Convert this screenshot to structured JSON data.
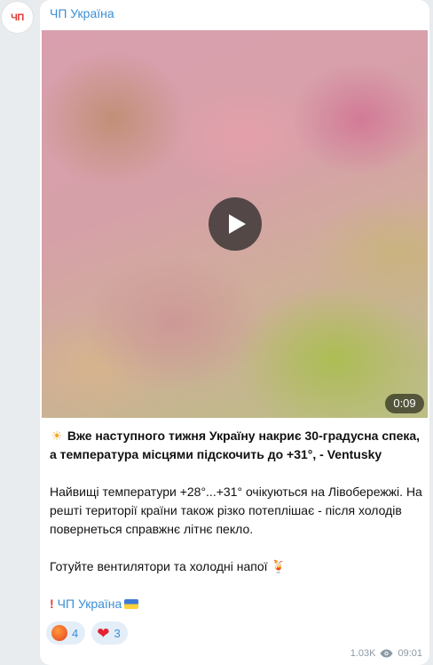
{
  "channel": {
    "avatar_text": "ЧП",
    "name": "ЧП Україна"
  },
  "video": {
    "duration": "0:09",
    "play_icon": "play-icon"
  },
  "post": {
    "headline": "Вже наступного тижня Україну накриє 30-градусна спека, а температура місцями підскочить до +31°, - Ventusky",
    "paragraph1": "Найвищі температури +28°...+31° очікуються на Лівобережжі. На решті території країни також різко потеплішає - після холодів повернеться справжнє літнє пекло.",
    "paragraph2": "Готуйте вентилятори та холодні напої",
    "signature": "ЧП Україна"
  },
  "reactions": [
    {
      "icon": "angry-face-icon",
      "count": "4"
    },
    {
      "icon": "heart-icon",
      "count": "3"
    }
  ],
  "meta": {
    "views": "1.03K",
    "time": "09:01"
  },
  "colors": {
    "accent": "#3a8ed6",
    "background": "#e8ecef",
    "bubble": "#ffffff"
  }
}
